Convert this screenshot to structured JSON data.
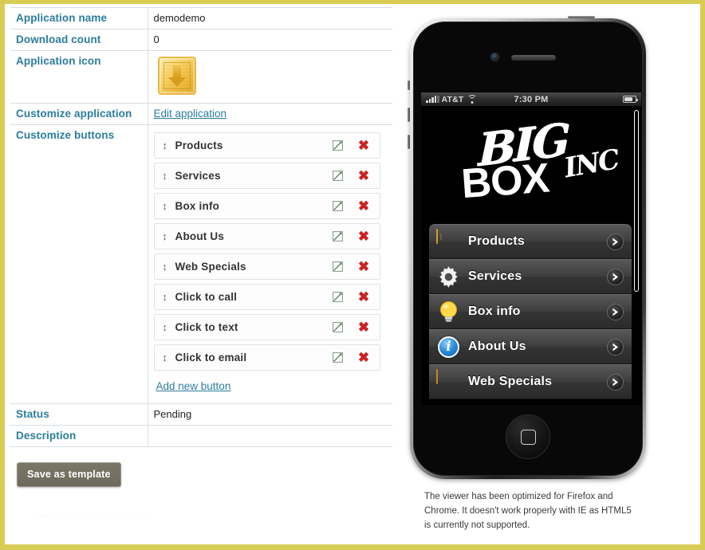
{
  "theme": {
    "page_border": "#d9cc55",
    "label_color": "#2b7d9e",
    "link_color": "#2b7d9e",
    "delete_color": "#cc2222",
    "save_button_bg": "#6d6a5c"
  },
  "properties": [
    {
      "label": "Application name",
      "value": "demodemo"
    },
    {
      "label": "Download count",
      "value": "0"
    },
    {
      "label": "Application icon",
      "value": ""
    },
    {
      "label": "Customize application",
      "value": "Edit application"
    },
    {
      "label": "Customize buttons",
      "value": ""
    },
    {
      "label": "Status",
      "value": "Pending"
    },
    {
      "label": "Description",
      "value": ""
    }
  ],
  "app": {
    "name_label": "Application name",
    "name_value": "demodemo",
    "download_label": "Download count",
    "download_value": "0",
    "icon_label": "Application icon",
    "icon_name": "download-box-icon",
    "customize_app_label": "Customize application",
    "edit_application_link": "Edit application",
    "customize_buttons_label": "Customize buttons",
    "status_label": "Status",
    "status_value": "Pending",
    "description_label": "Description",
    "description_value": ""
  },
  "buttons": [
    {
      "name": "Products"
    },
    {
      "name": "Services"
    },
    {
      "name": "Box info"
    },
    {
      "name": "About Us"
    },
    {
      "name": "Web Specials"
    },
    {
      "name": "Click to call"
    },
    {
      "name": "Click to text"
    },
    {
      "name": "Click to email"
    }
  ],
  "button_list": {
    "drag_handle_glyph": "↕",
    "delete_glyph": "✖",
    "add_new_label": "Add new button"
  },
  "toolbar": {
    "save_label": "Save as template"
  },
  "watermark": "www.thetemplatefinder.com",
  "phone": {
    "status_bar": {
      "carrier": "AT&T",
      "time": "7:30 PM"
    },
    "logo": {
      "big": "BIG",
      "box": "BOX",
      "inc": "INC"
    },
    "menu": [
      {
        "label": "Products",
        "icon": "box-icon"
      },
      {
        "label": "Services",
        "icon": "gear-icon"
      },
      {
        "label": "Box info",
        "icon": "lightbulb-icon"
      },
      {
        "label": "About Us",
        "icon": "info-circle-icon"
      },
      {
        "label": "Web Specials",
        "icon": "gold-card-icon"
      }
    ],
    "home_button": "home-button"
  },
  "viewer_note": "The viewer has been optimized for Firefox and Chrome. It doesn't work properly with IE as HTML5 is currently not supported."
}
